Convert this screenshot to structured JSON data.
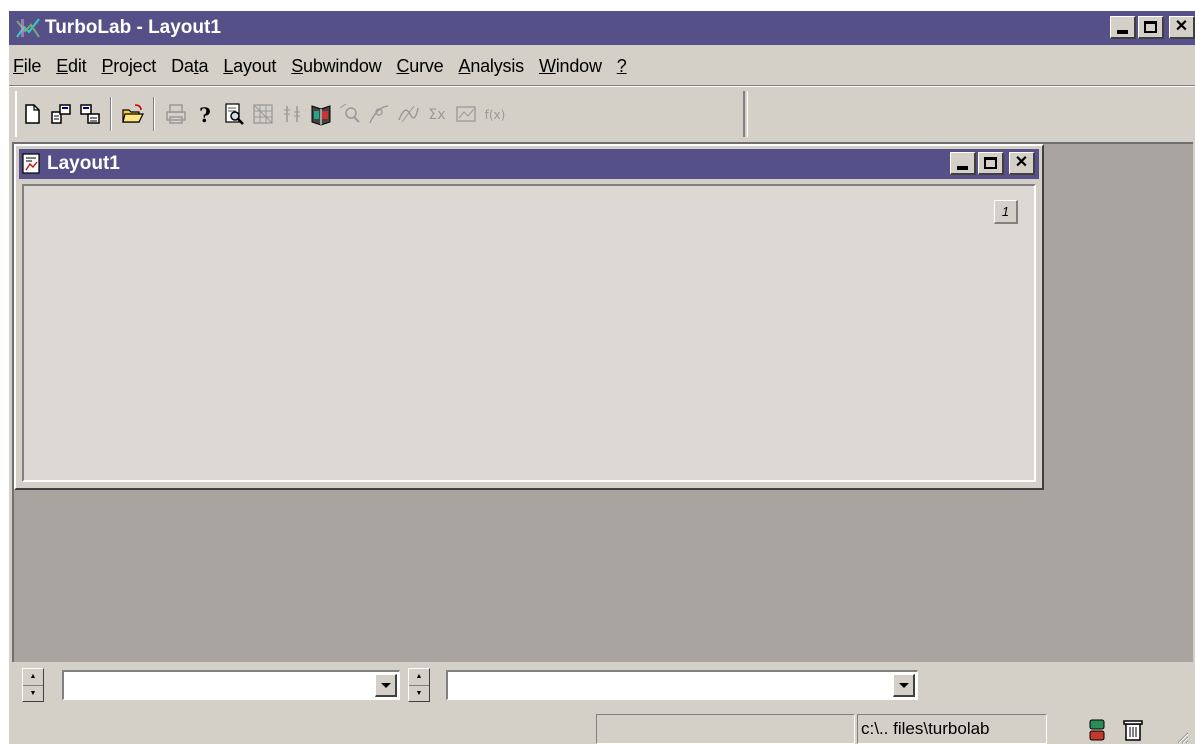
{
  "window": {
    "title": "TurboLab - Layout1",
    "title_bar_color": "#555188",
    "controls": [
      "minimize",
      "maximize",
      "close"
    ]
  },
  "menubar": {
    "items": [
      {
        "before": "",
        "u": "F",
        "after": "ile"
      },
      {
        "before": "",
        "u": "E",
        "after": "dit"
      },
      {
        "before": "",
        "u": "P",
        "after": "roject"
      },
      {
        "before": "Da",
        "u": "t",
        "after": "a"
      },
      {
        "before": "",
        "u": "L",
        "after": "ayout"
      },
      {
        "before": "",
        "u": "S",
        "after": "ubwindow"
      },
      {
        "before": "",
        "u": "C",
        "after": "urve"
      },
      {
        "before": "",
        "u": "A",
        "after": "nalysis"
      },
      {
        "before": "",
        "u": "W",
        "after": "indow"
      },
      {
        "before": "",
        "u": "?",
        "after": ""
      }
    ]
  },
  "toolbar": {
    "buttons": [
      {
        "icon": "new-document-icon",
        "enabled": true
      },
      {
        "icon": "new-project-icon",
        "enabled": true
      },
      {
        "icon": "project-window-icon",
        "enabled": true
      },
      {
        "icon": "open-folder-icon",
        "enabled": true
      },
      {
        "icon": "print-icon",
        "enabled": false
      },
      {
        "icon": "help-icon",
        "enabled": true
      },
      {
        "icon": "print-preview-icon",
        "enabled": true
      },
      {
        "icon": "table-icon",
        "enabled": false
      },
      {
        "icon": "data-columns-icon",
        "enabled": false
      },
      {
        "icon": "book-icon",
        "enabled": true
      },
      {
        "icon": "zoom-icon",
        "enabled": false
      },
      {
        "icon": "curve-pick-icon",
        "enabled": false
      },
      {
        "icon": "curve-fit-icon",
        "enabled": false
      },
      {
        "icon": "sum-icon",
        "enabled": false
      },
      {
        "icon": "chart-icon",
        "enabled": false
      },
      {
        "icon": "function-icon",
        "enabled": false
      }
    ],
    "function_label": "f(x)",
    "sum_label": "Σx"
  },
  "child_window": {
    "title": "Layout1",
    "page_number": "1"
  },
  "bottom": {
    "combo1_value": "",
    "combo2_value": ""
  },
  "status": {
    "message": "",
    "path": "c:\\.. files\\turbolab"
  }
}
